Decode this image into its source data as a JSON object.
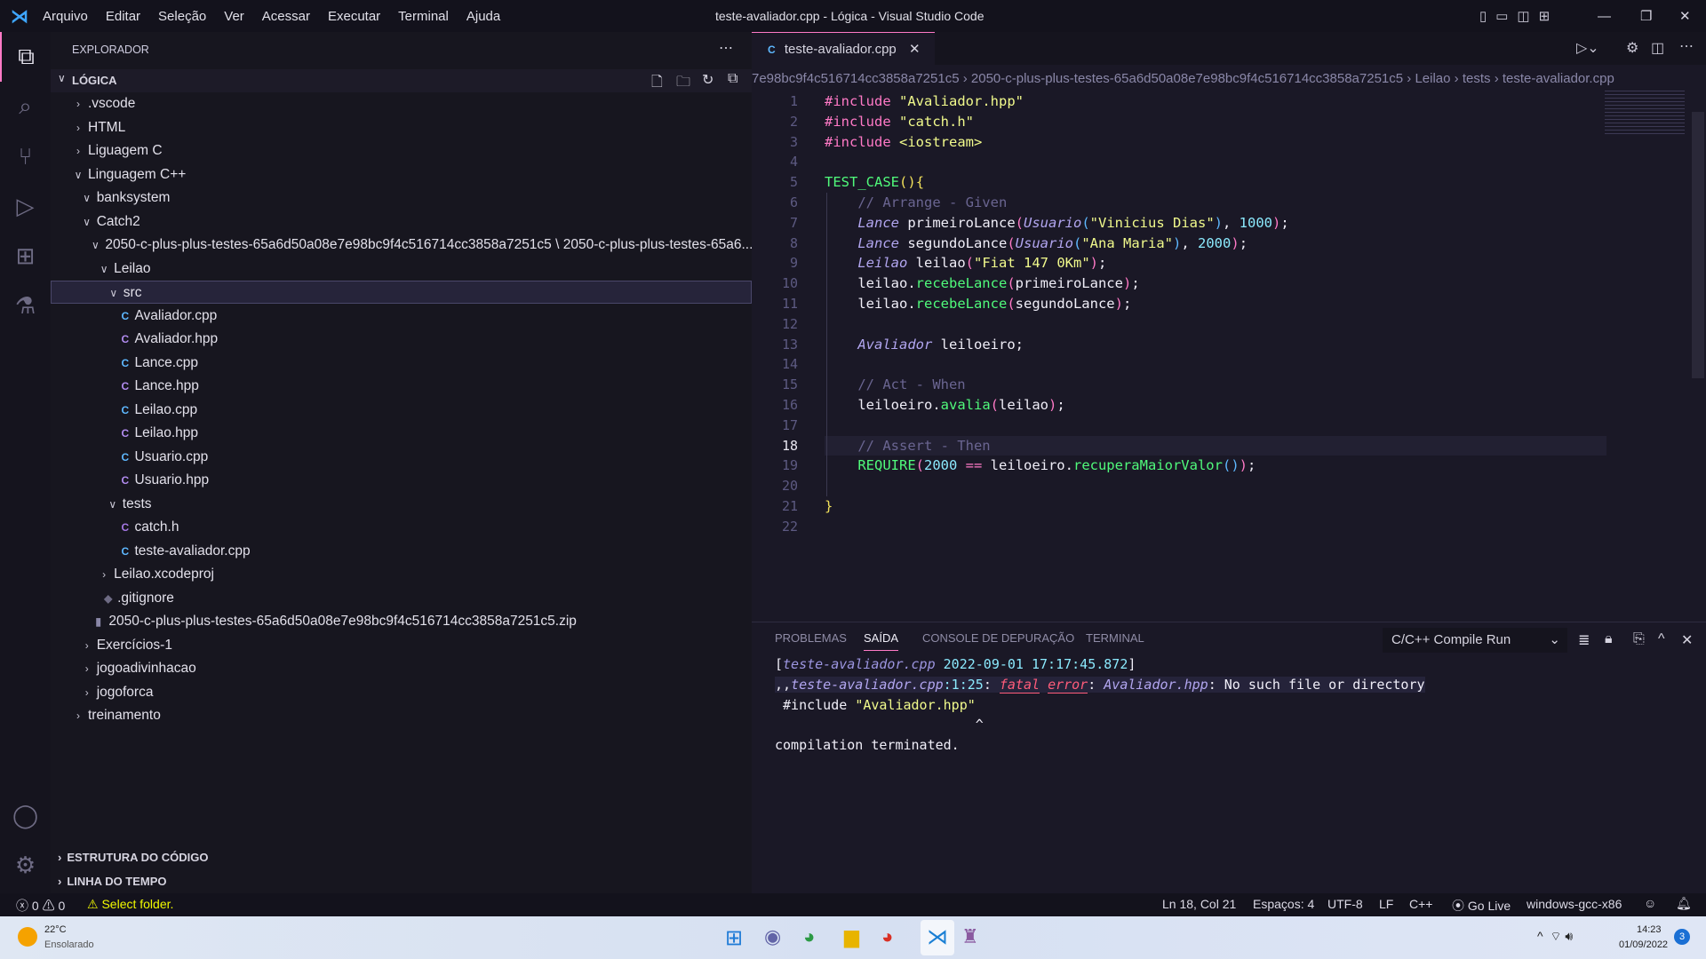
{
  "titlebar": {
    "menu": [
      "Arquivo",
      "Editar",
      "Seleção",
      "Ver",
      "Acessar",
      "Executar",
      "Terminal",
      "Ajuda"
    ],
    "title": "teste-avaliador.cpp - Lógica - Visual Studio Code"
  },
  "sidebar": {
    "header": "EXPLORADOR",
    "root": "LÓGICA",
    "tree": [
      {
        "label": ".vscode",
        "depth": 0,
        "kind": "folder",
        "open": false
      },
      {
        "label": "HTML",
        "depth": 0,
        "kind": "folder",
        "open": false
      },
      {
        "label": "Liguagem C",
        "depth": 0,
        "kind": "folder",
        "open": false
      },
      {
        "label": "Linguagem C++",
        "depth": 0,
        "kind": "folder",
        "open": true
      },
      {
        "label": "banksystem",
        "depth": 1,
        "kind": "folder",
        "open": true
      },
      {
        "label": "Catch2",
        "depth": 1,
        "kind": "folder",
        "open": true
      },
      {
        "label": "2050-c-plus-plus-testes-65a6d50a08e7e98bc9f4c516714cc3858a7251c5 \\ 2050-c-plus-plus-testes-65a6...",
        "depth": 2,
        "kind": "folder",
        "open": true
      },
      {
        "label": "Leilao",
        "depth": 3,
        "kind": "folder",
        "open": true
      },
      {
        "label": "src",
        "depth": 4,
        "kind": "folder",
        "open": true,
        "selected": true
      },
      {
        "label": "Avaliador.cpp",
        "depth": 5,
        "kind": "cpp"
      },
      {
        "label": "Avaliador.hpp",
        "depth": 5,
        "kind": "hpp"
      },
      {
        "label": "Lance.cpp",
        "depth": 5,
        "kind": "cpp"
      },
      {
        "label": "Lance.hpp",
        "depth": 5,
        "kind": "hpp"
      },
      {
        "label": "Leilao.cpp",
        "depth": 5,
        "kind": "cpp"
      },
      {
        "label": "Leilao.hpp",
        "depth": 5,
        "kind": "hpp"
      },
      {
        "label": "Usuario.cpp",
        "depth": 5,
        "kind": "cpp"
      },
      {
        "label": "Usuario.hpp",
        "depth": 5,
        "kind": "hpp"
      },
      {
        "label": "tests",
        "depth": 4,
        "kind": "folder",
        "open": true
      },
      {
        "label": "catch.h",
        "depth": 5,
        "kind": "c"
      },
      {
        "label": "teste-avaliador.cpp",
        "depth": 5,
        "kind": "cpp"
      },
      {
        "label": "Leilao.xcodeproj",
        "depth": 3,
        "kind": "folder",
        "open": false
      },
      {
        "label": ".gitignore",
        "depth": 3,
        "kind": "git"
      },
      {
        "label": "2050-c-plus-plus-testes-65a6d50a08e7e98bc9f4c516714cc3858a7251c5.zip",
        "depth": 2,
        "kind": "zip"
      },
      {
        "label": "Exercícios-1",
        "depth": 1,
        "kind": "folder",
        "open": false
      },
      {
        "label": "jogoadivinhacao",
        "depth": 1,
        "kind": "folder",
        "open": false
      },
      {
        "label": "jogoforca",
        "depth": 1,
        "kind": "folder",
        "open": false
      },
      {
        "label": "treinamento",
        "depth": 0,
        "kind": "folder",
        "open": false
      }
    ],
    "sections": [
      "ESTRUTURA DO CÓDIGO",
      "LINHA DO TEMPO"
    ]
  },
  "editor": {
    "tab": "teste-avaliador.cpp",
    "breadcrumb": [
      "7e98bc9f4c516714cc3858a7251c5",
      "2050-c-plus-plus-testes-65a6d50a08e7e98bc9f4c516714cc3858a7251c5",
      "Leilao",
      "tests",
      "teste-avaliador.cpp"
    ],
    "current_line": 18,
    "lines": [
      [
        [
          "#include ",
          "pp"
        ],
        [
          "\"Avaliador.hpp\"",
          "str"
        ]
      ],
      [
        [
          "#include ",
          "pp"
        ],
        [
          "\"catch.h\"",
          "str"
        ]
      ],
      [
        [
          "#include ",
          "pp"
        ],
        [
          "<iostream>",
          "str"
        ]
      ],
      [],
      [
        [
          "TEST_CASE",
          "fn"
        ],
        [
          "(",
          "p3"
        ],
        [
          ")",
          "p3"
        ],
        [
          "{",
          "p3"
        ]
      ],
      [
        [
          "    "
        ],
        [
          "// Arrange - Given",
          "cm"
        ]
      ],
      [
        [
          "    "
        ],
        [
          "Lance",
          "ty"
        ],
        [
          " primeiroLance",
          "pl"
        ],
        [
          "(",
          "p1"
        ],
        [
          "Usuario",
          "ty"
        ],
        [
          "(",
          "p2"
        ],
        [
          "\"Vinicius Dias\"",
          "str"
        ],
        [
          ")",
          "p2"
        ],
        [
          ", ",
          "pl"
        ],
        [
          "1000",
          "num"
        ],
        [
          ")",
          "p1"
        ],
        [
          ";",
          "pl"
        ]
      ],
      [
        [
          "    "
        ],
        [
          "Lance",
          "ty"
        ],
        [
          " segundoLance",
          "pl"
        ],
        [
          "(",
          "p1"
        ],
        [
          "Usuario",
          "ty"
        ],
        [
          "(",
          "p2"
        ],
        [
          "\"Ana Maria\"",
          "str"
        ],
        [
          ")",
          "p2"
        ],
        [
          ", ",
          "pl"
        ],
        [
          "2000",
          "num"
        ],
        [
          ")",
          "p1"
        ],
        [
          ";",
          "pl"
        ]
      ],
      [
        [
          "    "
        ],
        [
          "Leilao",
          "ty"
        ],
        [
          " leilao",
          "pl"
        ],
        [
          "(",
          "p1"
        ],
        [
          "\"Fiat 147 0Km\"",
          "str"
        ],
        [
          ")",
          "p1"
        ],
        [
          ";",
          "pl"
        ]
      ],
      [
        [
          "    "
        ],
        [
          "leilao.",
          "pl"
        ],
        [
          "recebeLance",
          "fn"
        ],
        [
          "(",
          "p1"
        ],
        [
          "primeiroLance",
          "pl"
        ],
        [
          ")",
          "p1"
        ],
        [
          ";",
          "pl"
        ]
      ],
      [
        [
          "    "
        ],
        [
          "leilao.",
          "pl"
        ],
        [
          "recebeLance",
          "fn"
        ],
        [
          "(",
          "p1"
        ],
        [
          "segundoLance",
          "pl"
        ],
        [
          ")",
          "p1"
        ],
        [
          ";",
          "pl"
        ]
      ],
      [],
      [
        [
          "    "
        ],
        [
          "Avaliador",
          "ty"
        ],
        [
          " leiloeiro;",
          "pl"
        ]
      ],
      [],
      [
        [
          "    "
        ],
        [
          "// Act - When",
          "cm"
        ]
      ],
      [
        [
          "    "
        ],
        [
          "leiloeiro.",
          "pl"
        ],
        [
          "avalia",
          "fn"
        ],
        [
          "(",
          "p1"
        ],
        [
          "leilao",
          "pl"
        ],
        [
          ")",
          "p1"
        ],
        [
          ";",
          "pl"
        ]
      ],
      [],
      [
        [
          "    "
        ],
        [
          "// Assert - Then",
          "cm"
        ]
      ],
      [
        [
          "    "
        ],
        [
          "REQUIRE",
          "fn"
        ],
        [
          "(",
          "p1"
        ],
        [
          "2000",
          "num"
        ],
        [
          " == ",
          "op"
        ],
        [
          "leiloeiro.",
          "pl"
        ],
        [
          "recuperaMaiorValor",
          "fn"
        ],
        [
          "(",
          "p2"
        ],
        [
          ")",
          "p2"
        ],
        [
          ")",
          "p1"
        ],
        [
          ";",
          "pl"
        ]
      ],
      [],
      [
        [
          "}",
          "p3"
        ]
      ],
      []
    ]
  },
  "panel": {
    "tabs": [
      "PROBLEMAS",
      "SAÍDA",
      "CONSOLE DE DEPURAÇÃO",
      "TERMINAL"
    ],
    "active_tab": "SAÍDA",
    "dropdown": "C/C++ Compile Run",
    "output": [
      [
        [
          "[",
          "pl"
        ],
        [
          "teste-avaliador.cpp",
          "ty"
        ],
        [
          " 2022-09-01 17:17:45.872",
          "num"
        ],
        [
          "]",
          "pl"
        ]
      ],
      [
        [
          ",,",
          "pl"
        ],
        [
          "teste-avaliador.cpp",
          "ty"
        ],
        [
          ":1:25",
          "num"
        ],
        [
          ": ",
          "pl"
        ],
        [
          "fatal",
          "err"
        ],
        [
          " ",
          "pl"
        ],
        [
          "error",
          "err"
        ],
        [
          ": ",
          "pl"
        ],
        [
          "Avaliador.hpp",
          "ty"
        ],
        [
          ": No such file or directory",
          "pl"
        ]
      ],
      [
        [
          " #include ",
          "pl"
        ],
        [
          "\"Avaliador.hpp\"",
          "str"
        ]
      ],
      [
        [
          "                         ^",
          "pl"
        ]
      ],
      [
        [
          "compilation terminated.",
          "pl"
        ]
      ]
    ]
  },
  "status": {
    "errors": "0",
    "warnings": "0",
    "select_folder": "Select folder.",
    "position": "Ln 18, Col 21",
    "spaces": "Espaços: 4",
    "encoding": "UTF-8",
    "eol": "LF",
    "language": "C++",
    "golive": "Go Live",
    "compiler": "windows-gcc-x86"
  },
  "taskbar": {
    "temp": "22°C",
    "weather": "Ensolarado",
    "time": "14:23",
    "date": "01/09/2022",
    "badge": "3"
  },
  "colors": {
    "background": "#1a1826",
    "accent": "#ff79c6",
    "status_warning": "#f1fa00"
  }
}
